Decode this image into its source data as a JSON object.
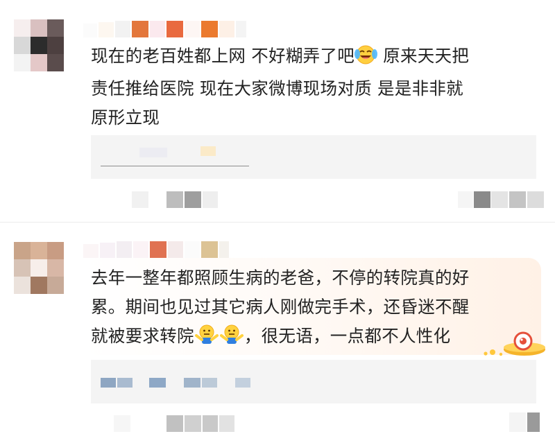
{
  "comments": [
    {
      "text_line1a": "现在的老百姓都上网  不好糊弄了吧",
      "text_line1b": "  原来天天把",
      "text_line2": "责任推给医院  现在大家微博现场对质  是是非非就",
      "text_line3": "原形立现",
      "emoji_icons": [
        "laughing-crying-emoji-icon"
      ]
    },
    {
      "text_line1": "去年一整年都照顾生病的老爸，不停的转院真的好",
      "text_line2": "累。期间也见过其它病人刚做完手术，还昏迷不醒",
      "text_line3a": "就被要求转院",
      "text_line3b": "，很无语，一点都不人性化",
      "emoji_icons": [
        "shrug-emoji-icon",
        "shrug-emoji-icon"
      ]
    }
  ],
  "colors": {
    "username_orange": "#e8864a",
    "username_red": "#e07050",
    "bubble_accent": "#ffe9d8",
    "reply_box_bg": "#f4f4f4",
    "blurred_blue": "#a9b9cc"
  }
}
